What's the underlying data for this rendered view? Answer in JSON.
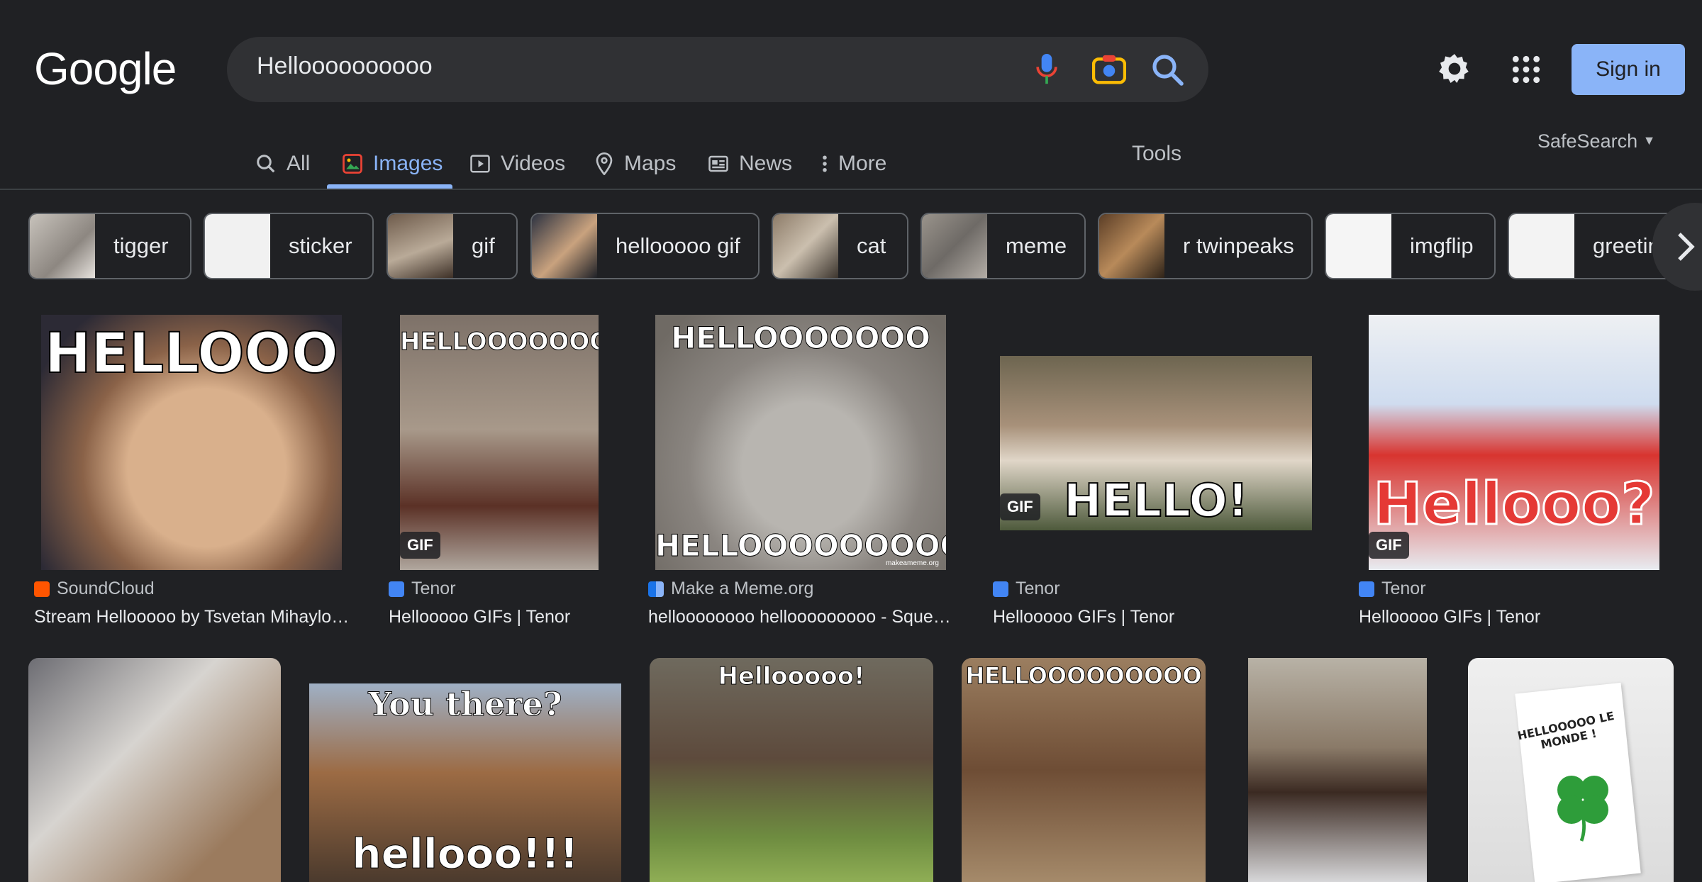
{
  "header": {
    "logo": "Google",
    "search_value": "Helloooooooooo",
    "sign_in": "Sign in"
  },
  "tabs": [
    {
      "label": "All",
      "icon": "search-icon"
    },
    {
      "label": "Images",
      "icon": "image-icon",
      "active": true
    },
    {
      "label": "Videos",
      "icon": "play-icon"
    },
    {
      "label": "Maps",
      "icon": "map-pin-icon"
    },
    {
      "label": "News",
      "icon": "news-icon"
    },
    {
      "label": "More",
      "icon": "kebab-icon"
    }
  ],
  "tools_label": "Tools",
  "safesearch_label": "SafeSearch",
  "chips": [
    "tigger",
    "sticker",
    "gif",
    "hellooooo gif",
    "cat",
    "meme",
    "r twinpeaks",
    "imgflip",
    "greetin"
  ],
  "results": [
    {
      "source": "SoundCloud",
      "title": "Stream Hellooooo by Tsvetan Mihaylov…",
      "overlay": "HELLOOO",
      "gif": false
    },
    {
      "source": "Tenor",
      "title": "Hellooooo GIFs | Tenor",
      "overlay": "HELLOOOOOOOO!",
      "gif": true
    },
    {
      "source": "Make a Meme.org",
      "title": "helloooooooo hellooooooooo - Squeami…",
      "overlay_top": "HELLOOOOOOO",
      "overlay_bottom": "HELLOOOOOOOOO",
      "watermark": "makeameme.org",
      "gif": false
    },
    {
      "source": "Tenor",
      "title": "Hellooooo GIFs | Tenor",
      "overlay": "HELLO!",
      "gif": true
    },
    {
      "source": "Tenor",
      "title": "Hellooooo GIFs | Tenor",
      "overlay": "Hellooo?",
      "gif": true
    }
  ],
  "row2": [
    {
      "overlay": ""
    },
    {
      "overlay_top": "You there?",
      "overlay_bottom": "hellooo!!!"
    },
    {
      "overlay": "Hellooooo!"
    },
    {
      "overlay": "HELLOOOOOOOOO"
    },
    {
      "overlay": ""
    },
    {
      "overlay": "HELLOOOOO LE MONDE !"
    }
  ],
  "gif_badge": "GIF",
  "colors": {
    "background": "#202124",
    "accent": "#8ab4f8",
    "search_box": "#303134",
    "muted_text": "#bdc1c6"
  }
}
